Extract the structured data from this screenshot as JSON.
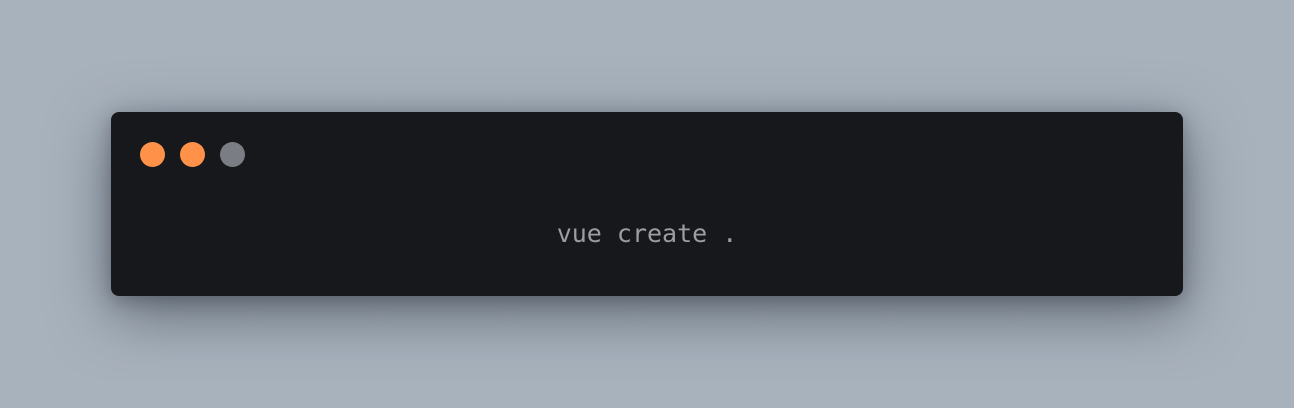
{
  "window": {
    "controls": [
      {
        "name": "close-button",
        "color": "#ff9248"
      },
      {
        "name": "minimize-button",
        "color": "#ff9248"
      },
      {
        "name": "maximize-button",
        "color": "#7a7e84"
      }
    ]
  },
  "code": {
    "line": "vue create ."
  },
  "colors": {
    "background": "#a8b2bd",
    "window": "#17181b",
    "text": "#9a9ea3"
  }
}
